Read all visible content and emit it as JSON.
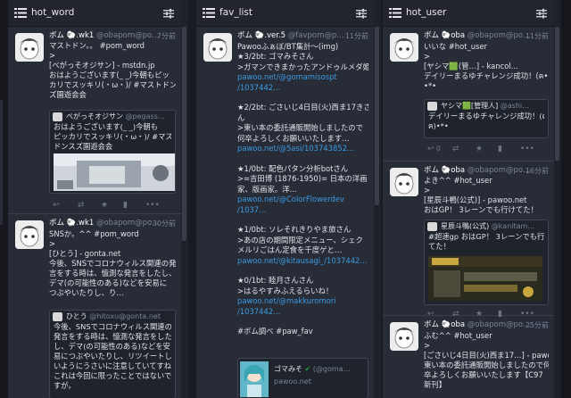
{
  "columns": [
    {
      "title": "hot_word",
      "toots": [
        {
          "display_name": "ボム 🐑.wk1",
          "acct": "@obapom@po…",
          "time": "7分前",
          "lines": [
            "マストドン。。 #pom_word",
            ">",
            "[べがっそオジサン] - mstdn.jp",
            "おはようございます(_ _)今朝もピッ",
            "カリでスッキリ(・ω・)/ #マストドンス",
            "ズ園遊会会"
          ],
          "card": {
            "name": "べがっそオジサン",
            "acct": "@pegass…",
            "lines": [
              "おはようございます(_ _)今朝も",
              "ピッカリでスッキリ(・ω・)/ #マスト",
              "ドンスズ園遊会会"
            ]
          }
        },
        {
          "display_name": "ボム 🐑.wk1",
          "acct": "@obapom@po…",
          "time": "30分前",
          "lines": [
            "SNSか。^^ #pom_word",
            ">",
            "[ひとう] - gonta.net",
            "今後、SNSでコロナウィルス関連の発",
            "言をする時は、憶測な発言をしたし、",
            "デマ(の可能性のある)などを安易に",
            "つぶやいたりし、り…"
          ],
          "card": {
            "name": "ひとう",
            "acct": "@hitoxu@gonta.net",
            "lines": [
              "今後、SNSでコロナウィルス関連の",
              "発言をする時は、憶測な発言をした",
              "し、デマ(の可能性のある)などを安",
              "易につぶやいたりし、リツイートしな",
              "いようにうさいに注意していてすね。",
              "これは今回に限ったことではないで",
              "すが。"
            ]
          }
        }
      ]
    },
    {
      "title": "fav_list",
      "toots": [
        {
          "display_name": "ボム 🐑.ver.5",
          "acct": "@favpom@p…",
          "time": "11分前",
          "lines": [
            "Pawooふぁぼ/BT集計〜(img)",
            "",
            "★3/2bt: ゴマみそさん",
            ">ガマンできまかったアンドゥルメダ姫",
            "pawoo.net/@gomamisospt",
            "/1037442…",
            "",
            "★2/2bt: ごさいじ4日目(火)西ま17きさ",
            "ん",
            ">東い本の委託通販開始しましたので",
            "何卒よろしくお願いいたします…",
            "pawoo.net/@5asi/103743852…",
            "",
            "★1/0bt: 配色パタン分析botさん",
            ">=吉田博 (1876-1950)= 日本の洋画",
            "家、版画家。洋…",
            "pawoo.net/@ColorFlowerdev",
            "/1037…",
            "",
            "★1/0bt: ソレそれきりやま旅さん",
            ">あの店の期間限定メニュー、シェク",
            "メルリごはん定食を千度ゲと…",
            "pawoo.net/@kitausagi_/1037442…",
            "",
            "★0/1bt: 睦月さんさん",
            ">はるやすみふえるらいね！",
            "pawoo.net/@makkuromori",
            "/1037442…",
            "",
            "#ボム調べ #paw_fav"
          ],
          "card": {
            "name": "ゴマみそ",
            "acct": "(@goma…",
            "lines": [
              "pawoo.net"
            ]
          }
        }
      ]
    },
    {
      "title": "hot_user",
      "toots": [
        {
          "display_name": "ボム 🐑oba",
          "acct": "@obapom@po…",
          "time": "11分前",
          "lines": [
            "いいな #hot_user",
            ">",
            "[ヤシマ🟩(管…] - kancol…",
            "デイリーまるゆチャレンジ成功！(ฅ•ω•ฅ)",
            "•*•"
          ],
          "card": {
            "name": "ヤシマ🟩[管理人]",
            "acct": "@ashi…",
            "lines": [
              "デイリーまるゆチャレンジ成功！(ฅ•ω•",
              "ฅ)•*•"
            ]
          }
        },
        {
          "display_name": "ボム 🐑oba",
          "acct": "@obapom@po…",
          "time": "16分前",
          "lines": [
            "よき^^ #hot_user",
            ">",
            "[星辰斗鴨(公式)] - pawoo.net",
            "おはGP！ 3レーンでも行けてた！"
          ],
          "card": {
            "name": "星辰斗鴨(公式)",
            "acct": "@kanitam…",
            "lines": [
              "#超速gp おはGP！ 3レーンでも行け",
              "てた！"
            ]
          }
        },
        {
          "display_name": "ボム 🐑oba",
          "acct": "@obapom@po…",
          "time": "25分前",
          "lines": [
            "ふむ^^ #hot_user",
            ">",
            "[ごさいじ4日目(火)西ま17…] - pawoo…",
            "東い本の委託通販開始しましたので何",
            "卒よろしくお願いいたします【C97",
            "新刊】"
          ],
          "card": null
        }
      ]
    }
  ],
  "actions": [
    "reply-icon",
    "boost-icon",
    "favourite-icon",
    "bookmark-icon",
    "more-icon"
  ],
  "reply_count": "0",
  "colors": {
    "link": "#3b9ae0",
    "column_bg": "#282c37",
    "header_bg": "#22252e",
    "text": "#e1e3ea",
    "muted": "#7a8599"
  }
}
